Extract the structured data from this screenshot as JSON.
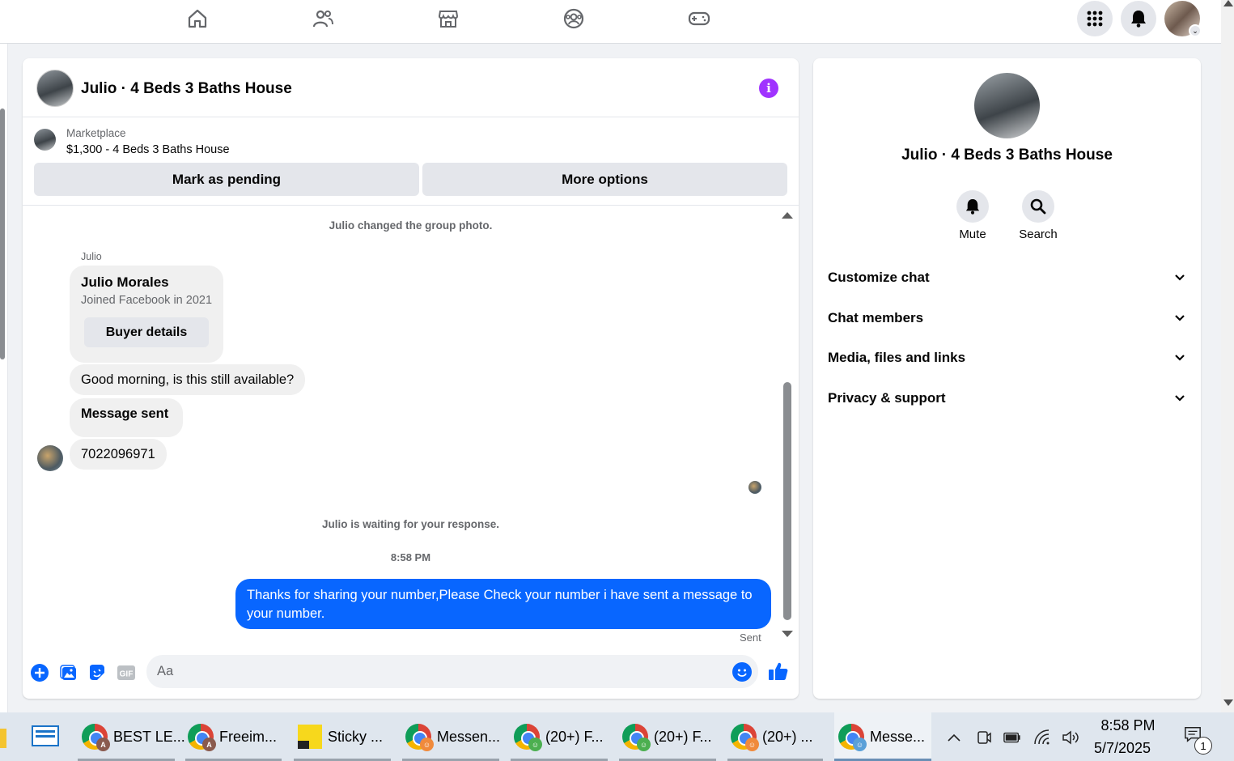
{
  "nav": {
    "icons": [
      "home-icon",
      "friends-icon",
      "marketplace-icon",
      "groups-icon",
      "gaming-icon"
    ],
    "right_icons": [
      "menu-grid-icon",
      "notifications-bell-icon",
      "profile-avatar"
    ]
  },
  "chat": {
    "title": "Julio · 4 Beds 3 Baths House",
    "marketplace": {
      "label": "Marketplace",
      "listing": "$1,300 - 4 Beds 3 Baths House",
      "mark_pending": "Mark as pending",
      "more_options": "More options"
    },
    "notice_group_photo": "Julio changed the group photo.",
    "sender_name": "Julio",
    "buyer_card": {
      "name": "Julio Morales",
      "joined": "Joined Facebook in 2021",
      "button": "Buyer details"
    },
    "messages_in": [
      "Good morning, is this still available?",
      "Message sent",
      "7022096971"
    ],
    "notice_waiting": "Julio is waiting for your response.",
    "timestamp": "8:58 PM",
    "message_out": "Thanks for sharing your number,Please Check your number i have sent a message to your number.",
    "sent_status": "Sent",
    "composer": {
      "placeholder": "Aa",
      "icons": [
        "plus-circle-icon",
        "photo-icon",
        "sticker-icon",
        "gif-icon",
        "emoji-icon",
        "thumbs-up-icon"
      ]
    }
  },
  "info_panel": {
    "title": "Julio · 4 Beds 3 Baths House",
    "actions": [
      {
        "label": "Mute",
        "icon": "bell-icon"
      },
      {
        "label": "Search",
        "icon": "search-icon"
      }
    ],
    "sections": [
      "Customize chat",
      "Chat members",
      "Media, files and links",
      "Privacy & support"
    ]
  },
  "taskbar": {
    "items": [
      {
        "label": "BEST LE...",
        "badge": "A",
        "badge_color": "#8a5a4e"
      },
      {
        "label": "Freeim...",
        "badge": "A",
        "badge_color": "#8a5a4e"
      },
      {
        "label": "Sticky ..."
      },
      {
        "label": "Messen...",
        "badge_color": "#f08a3c"
      },
      {
        "label": "(20+) F...",
        "badge_color": "#4caf50"
      },
      {
        "label": "(20+) F...",
        "badge_color": "#4caf50"
      },
      {
        "label": "(20+) ...",
        "badge_color": "#f08a3c"
      },
      {
        "label": "Messe...",
        "badge_color": "#5aa0d8"
      }
    ],
    "time": "8:58 PM",
    "date": "5/7/2025",
    "notification_count": "1"
  },
  "colors": {
    "accent_blue": "#0866ff",
    "info_purple": "#a033ff",
    "bubble_gray": "#f0f0f0",
    "button_gray": "#e4e6eb"
  }
}
